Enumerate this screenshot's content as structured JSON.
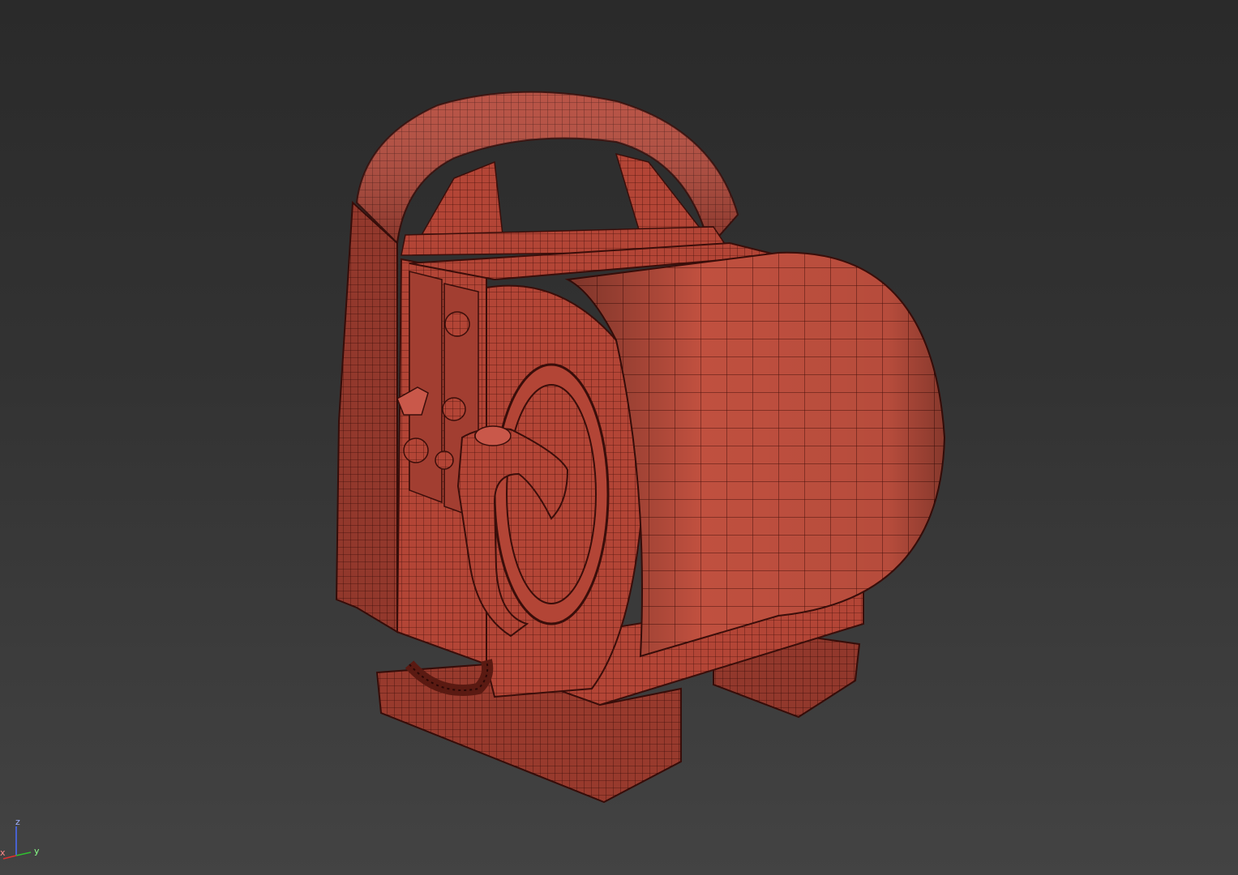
{
  "viewport": {
    "background_top": "#2a2a2a",
    "background_bottom": "#434343"
  },
  "model": {
    "surface_color": "#b84a3a",
    "surface_light": "#c95a47",
    "surface_dark": "#7a2a20",
    "wire_color": "#3a0e0a"
  },
  "axis_gizmo": {
    "z_label": "z",
    "x_label": "x",
    "y_label": "y",
    "z_color": "#4a6cff",
    "x_color": "#e03030",
    "y_color": "#30c030"
  }
}
